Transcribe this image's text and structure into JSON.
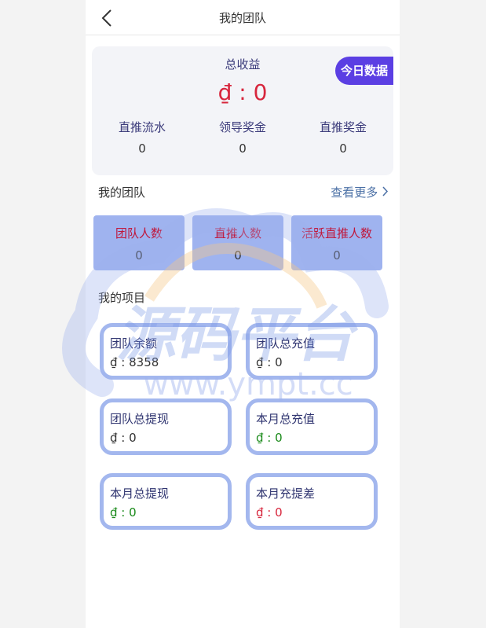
{
  "header": {
    "title": "我的团队"
  },
  "summary": {
    "total_label": "总收益",
    "total_value": "₫ : 0",
    "today_button": "今日数据",
    "stats": [
      {
        "label": "直推流水",
        "value": "0"
      },
      {
        "label": "领导奖金",
        "value": "0"
      },
      {
        "label": "直推奖金",
        "value": "0"
      }
    ]
  },
  "team": {
    "title": "我的团队",
    "more": "查看更多",
    "cards": [
      {
        "label": "团队人数",
        "value": "0"
      },
      {
        "label": "直推人数",
        "value": "0"
      },
      {
        "label": "活跃直推人数",
        "value": "0"
      }
    ]
  },
  "projects": {
    "title": "我的项目",
    "cards": [
      {
        "label": "团队余额",
        "value": "₫ : 8358"
      },
      {
        "label": "团队总充值",
        "value": "₫ : 0"
      },
      {
        "label": "团队总提现",
        "value": "₫ : 0"
      },
      {
        "label": "本月总充值",
        "value": "₫ : 0"
      },
      {
        "label": "本月总提现",
        "value": "₫ : 0"
      },
      {
        "label": "本月充提差",
        "value": "₫ : 0"
      }
    ]
  },
  "watermark": {
    "text": "源码平台",
    "url": "www.ympt.cc"
  },
  "colors": {
    "accent": "#5b3fe3",
    "card": "#9fb3ef",
    "red": "#d7263d",
    "green": "#1a8a1a"
  }
}
